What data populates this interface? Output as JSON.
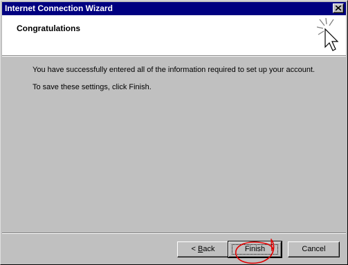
{
  "window": {
    "title": "Internet Connection Wizard"
  },
  "header": {
    "title": "Congratulations",
    "icon": "wizard-cursor-sparkle-icon"
  },
  "body": {
    "line1": "You have successfully entered all of the information required to set up your account.",
    "line2": "To save these settings, click Finish."
  },
  "buttons": {
    "back_prefix": "< ",
    "back_mnemonic": "B",
    "back_rest": "ack",
    "finish_label": "Finish",
    "cancel_label": "Cancel"
  },
  "colors": {
    "titlebar": "#000080",
    "face": "#c0c0c0",
    "annotation": "#e00000"
  }
}
